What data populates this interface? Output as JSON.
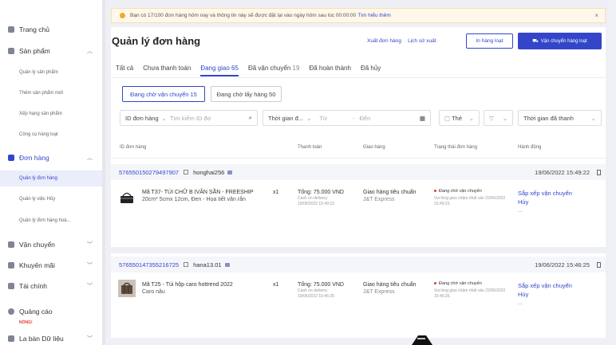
{
  "sidebar": {
    "home": "Trang chủ",
    "products": "Sản phẩm",
    "product_items": [
      "Quản lý sản phẩm",
      "Thêm sản phẩm mới",
      "Xếp hạng sản phẩm",
      "Công cụ hàng loạt"
    ],
    "orders": "Đơn hàng",
    "order_items": [
      "Quản lý đơn hàng",
      "Quản lý việc Hủy",
      "Quản lý đơn hàng hoà..."
    ],
    "shipping": "Vận chuyển",
    "promotions": "Khuyến mãi",
    "finance": "Tài chính",
    "ads": "Quảng cáo",
    "ads_badge": "NÓNG!",
    "data": "La bàn Dữ liệu"
  },
  "notice": {
    "text": "Bạn có 17/100 đơn hàng hôm nay và thông tin này sẽ được đặt lại vào ngày hôm sau lúc 00:00:00",
    "link": "Tìm hiểu thêm"
  },
  "page": {
    "title": "Quản lý đơn hàng",
    "export_label": "Xuất đơn hàng",
    "history_label": "Lịch sử xuất",
    "print_button": "In hàng loạt",
    "ship_button": "Vận chuyển hàng loạt"
  },
  "tabs": [
    {
      "label": "Tất cả",
      "count": ""
    },
    {
      "label": "Chưa thanh toán",
      "count": ""
    },
    {
      "label": "Đang giao",
      "count": "65"
    },
    {
      "label": "Đã vận chuyển",
      "count": "19"
    },
    {
      "label": "Đã hoàn thành",
      "count": ""
    },
    {
      "label": "Đã hủy",
      "count": ""
    }
  ],
  "sub_tabs": [
    "Đang chờ vận chuyển 15",
    "Đang chờ lấy hàng 50"
  ],
  "filters": {
    "id_select": "ID đơn hàng",
    "search_placeholder": "Tìm kiếm ID đơ",
    "time_select": "Thời gian đ...",
    "from": "Từ",
    "to": "Đến",
    "tag": "Thẻ",
    "sort": "Thời gian đã thanh"
  },
  "columns": [
    "ID đơn hàng",
    "Thanh toán",
    "Giao hàng",
    "Trạng thái đơn hàng",
    "Hành động"
  ],
  "orders": [
    {
      "id": "576550150279497907",
      "user": "honghai256",
      "date": "19/06/2022 15:49:22",
      "product": "Mã T37- TÚI CHỮ B ỊVÂN SẦN - FREESHIP",
      "variant": "20cm* 5cmx 12cm, Đen - Họa tiết vân rắn",
      "qty": "x1",
      "total": "Tổng: 75.000 VND",
      "method": "Cash on delivery",
      "paid_at": "19/06/2022 15:49:23",
      "ship_type": "Giao hàng tiêu chuẩn",
      "carrier": "J&T Express",
      "status": "Đang chờ vận chuyển",
      "status_note": "Vui lòng giao chậm nhất vào 22/06/2022 15:49:23.",
      "action1": "Sắp xếp vận chuyển",
      "action2": "Hủy",
      "more": "..."
    },
    {
      "id": "576550147355216725",
      "user": "hana13.01",
      "date": "19/06/2022 15:46:25",
      "product": "Mã T25 - Túi hộp caro hottrend 2022",
      "variant": "Caro nâu",
      "qty": "x1",
      "total": "Tổng: 75.000 VND",
      "method": "Cash on delivery",
      "paid_at": "19/06/2022 15:46:25",
      "ship_type": "Giao hàng tiêu chuẩn",
      "carrier": "J&T Express",
      "status": "Đang chờ vận chuyển",
      "status_note": "Vui lòng giao chậm nhất vào 22/06/2022 15:46:25.",
      "action1": "Sắp xếp vận chuyển",
      "action2": "Hủy",
      "more": "..."
    }
  ],
  "colors": {
    "accent": "#3346c9",
    "warning": "#f5a623",
    "danger": "#e53935"
  }
}
